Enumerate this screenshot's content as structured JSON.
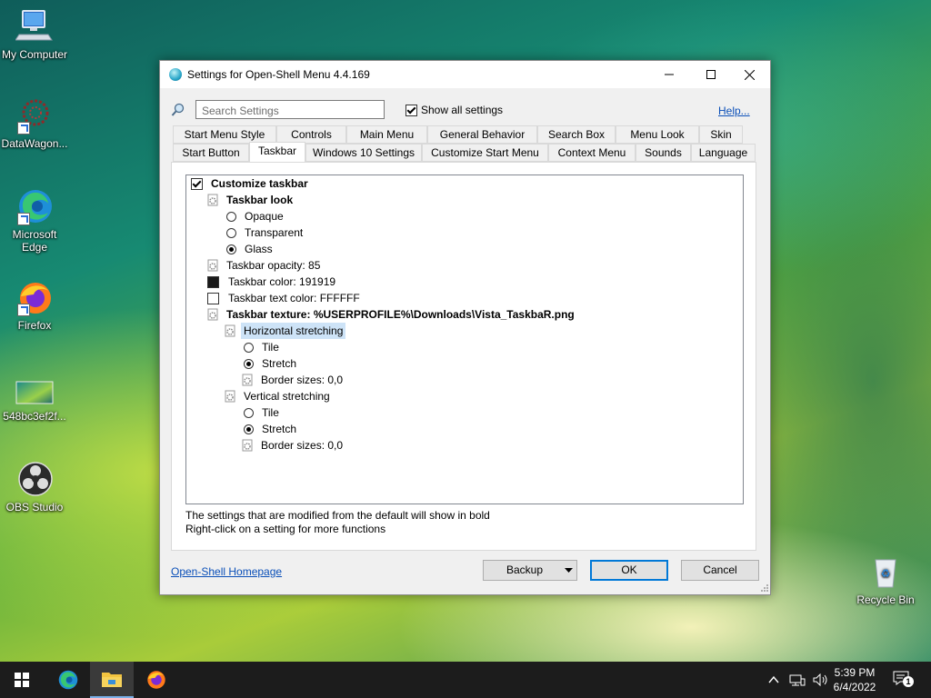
{
  "desktop": {
    "icons": [
      {
        "label": "My Computer"
      },
      {
        "label": "DataWagon..."
      },
      {
        "label": "Microsoft Edge"
      },
      {
        "label": "Firefox"
      },
      {
        "label": "548bc3ef2f..."
      },
      {
        "label": "OBS Studio"
      },
      {
        "label": "Recycle Bin"
      }
    ]
  },
  "window": {
    "title": "Settings for Open-Shell Menu 4.4.169",
    "search_placeholder": "Search Settings",
    "show_all_label": "Show all settings",
    "help_label": "Help...",
    "tabs_row1": [
      "Start Menu Style",
      "Controls",
      "Main Menu",
      "General Behavior",
      "Search Box",
      "Menu Look",
      "Skin"
    ],
    "tabs_row2": [
      "Start Button",
      "Taskbar",
      "Windows 10 Settings",
      "Customize Start Menu",
      "Context Menu",
      "Sounds",
      "Language"
    ],
    "active_tab": "Taskbar",
    "tree": {
      "customize_taskbar": "Customize taskbar",
      "taskbar_look": "Taskbar look",
      "opaque": "Opaque",
      "transparent": "Transparent",
      "glass": "Glass",
      "opacity": "Taskbar opacity: 85",
      "color": "Taskbar color: 191919",
      "text_color": "Taskbar text color: FFFFFF",
      "texture": "Taskbar texture: %USERPROFILE%\\Downloads\\Vista_TaskbaR.png",
      "h_stretch": "Horizontal stretching",
      "h_tile": "Tile",
      "h_stretch_opt": "Stretch",
      "h_border": "Border sizes: 0,0",
      "v_stretch": "Vertical stretching",
      "v_tile": "Tile",
      "v_stretch_opt": "Stretch",
      "v_border": "Border sizes: 0,0"
    },
    "swatch_colors": {
      "taskbar": "#191919",
      "text": "#FFFFFF"
    },
    "info_line1": "The settings that are modified from the default will show in bold",
    "info_line2": "Right-click on a setting for more functions",
    "homepage_link": "Open-Shell Homepage",
    "backup_label": "Backup",
    "ok_label": "OK",
    "cancel_label": "Cancel"
  },
  "taskbar": {
    "time": "5:39 PM",
    "date": "6/4/2022",
    "notification_count": "1"
  }
}
